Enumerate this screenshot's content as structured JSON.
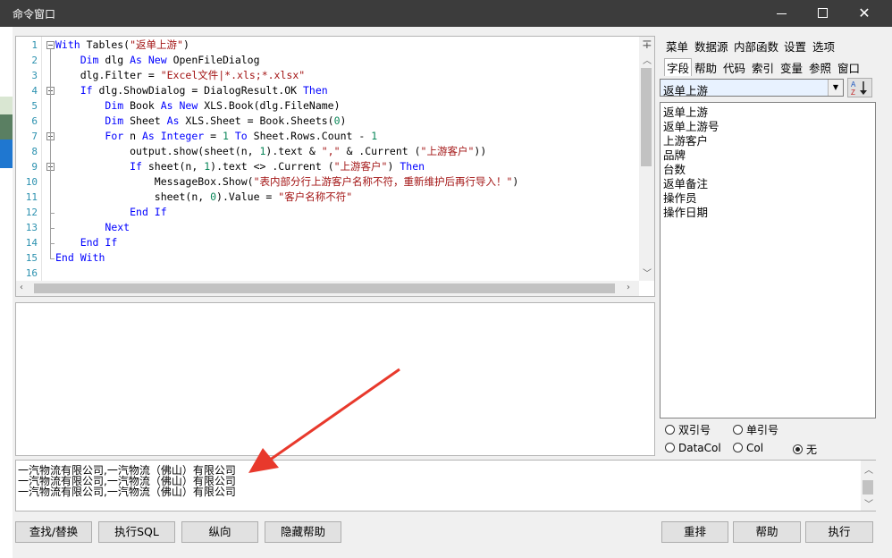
{
  "window": {
    "title": "命令窗口"
  },
  "editor": {
    "lines": [
      {
        "n": "1",
        "html": "<span class='kw'>With</span> Tables(<span class='str'>\"返单上游\"</span>)"
      },
      {
        "n": "2",
        "html": "    <span class='kw'>Dim</span> dlg <span class='kw'>As New</span> OpenFileDialog"
      },
      {
        "n": "3",
        "html": "    dlg.Filter = <span class='str'>\"Excel文件|*.xls;*.xlsx\"</span>"
      },
      {
        "n": "4",
        "html": "    <span class='kw'>If</span> dlg.ShowDialog = DialogResult.OK <span class='kw'>Then</span>"
      },
      {
        "n": "5",
        "html": "        <span class='kw'>Dim</span> Book <span class='kw'>As New</span> XLS.Book(dlg.FileName)"
      },
      {
        "n": "6",
        "html": "        <span class='kw'>Dim</span> Sheet <span class='kw'>As</span> XLS.Sheet = Book.Sheets(<span class='num'>0</span>)"
      },
      {
        "n": "7",
        "html": "        <span class='kw'>For</span> n <span class='kw'>As Integer</span> = <span class='num'>1</span> <span class='kw'>To</span> Sheet.Rows.Count - <span class='num'>1</span>"
      },
      {
        "n": "8",
        "html": "            output.show(sheet(n, <span class='num'>1</span>).text &amp; <span class='str'>\",\"</span> &amp; .Current (<span class='str'>\"上游客户\"</span>))"
      },
      {
        "n": "9",
        "html": "            <span class='kw'>If</span> sheet(n, <span class='num'>1</span>).text &lt;&gt; .Current (<span class='str'>\"上游客户\"</span>) <span class='kw'>Then</span>"
      },
      {
        "n": "10",
        "html": "                MessageBox.Show(<span class='str'>\"表内部分行上游客户名称不符，重新维护后再行导入！\"</span>)"
      },
      {
        "n": "11",
        "html": "                sheet(n, <span class='num'>0</span>).Value = <span class='str'>\"客户名称不符\"</span>"
      },
      {
        "n": "12",
        "html": "            <span class='kw'>End If</span>"
      },
      {
        "n": "13",
        "html": "        <span class='kw'>Next</span>"
      },
      {
        "n": "14",
        "html": "    <span class='kw'>End If</span>"
      },
      {
        "n": "15",
        "html": "<span class='kw'>End With</span>"
      },
      {
        "n": "16",
        "html": ""
      }
    ]
  },
  "output": {
    "lines": [
      "一汽物流有限公司,一汽物流（佛山）有限公司",
      "一汽物流有限公司,一汽物流（佛山）有限公司",
      "一汽物流有限公司,一汽物流（佛山）有限公司"
    ]
  },
  "right": {
    "tabs_row1": [
      "菜单",
      "数据源",
      "内部函数",
      "设置",
      "选项"
    ],
    "tabs_row2": [
      "字段",
      "帮助",
      "代码",
      "索引",
      "变量",
      "参照",
      "窗口"
    ],
    "combo_value": "返单上游",
    "fields": [
      "返单上游",
      "返单上游号",
      "上游客户",
      "品牌",
      "台数",
      "返单备注",
      "操作员",
      "操作日期"
    ],
    "radios": {
      "double_quote": "双引号",
      "single_quote": "单引号",
      "datacol": "DataCol",
      "col": "Col",
      "none": "无"
    }
  },
  "buttons": {
    "find_replace": "查找/替换",
    "exec_sql": "执行SQL",
    "vertical": "纵向",
    "hide_help": "隐藏帮助",
    "rearrange": "重排",
    "help": "帮助",
    "execute": "执行"
  },
  "colors": {
    "keyword": "#0000ff",
    "string": "#a31515",
    "number": "#098658",
    "linenum": "#2b91af",
    "arrow": "#e8392c"
  }
}
